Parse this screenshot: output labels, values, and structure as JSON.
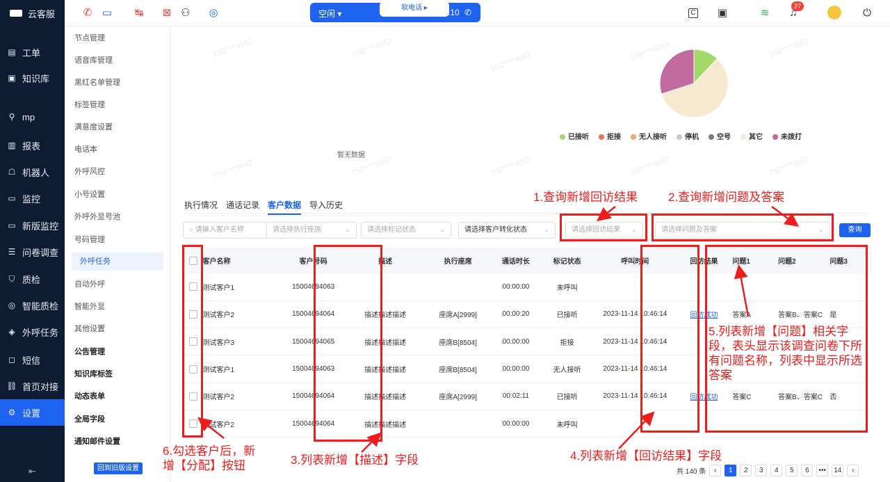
{
  "app_name": "云客服",
  "left_nav": [
    {
      "label": "工单",
      "icon": "ticket-icon"
    },
    {
      "label": "知识库",
      "icon": "book-icon"
    },
    {
      "label": "mp",
      "icon": "user-icon"
    },
    {
      "label": "报表",
      "icon": "chart-icon"
    },
    {
      "label": "机器人",
      "icon": "robot-icon"
    },
    {
      "label": "监控",
      "icon": "monitor-icon"
    },
    {
      "label": "新版监控",
      "icon": "monitor-icon"
    },
    {
      "label": "问卷调查",
      "icon": "survey-icon"
    },
    {
      "label": "质检",
      "icon": "shield-icon"
    },
    {
      "label": "智能质检",
      "icon": "target-icon"
    },
    {
      "label": "外呼任务",
      "icon": "layers-icon"
    },
    {
      "label": "短信",
      "icon": "message-icon"
    },
    {
      "label": "首页对接",
      "icon": "link-icon"
    },
    {
      "label": "设置",
      "icon": "gear-icon"
    }
  ],
  "sub_nav": [
    {
      "label": "节点管理"
    },
    {
      "label": "语音库管理"
    },
    {
      "label": "黑红名单管理"
    },
    {
      "label": "标签管理"
    },
    {
      "label": "满意度设置"
    },
    {
      "label": "电话本"
    },
    {
      "label": "外呼风控"
    },
    {
      "label": "小号设置"
    },
    {
      "label": "外呼外显号池"
    },
    {
      "label": "号码管理"
    },
    {
      "label": "外呼任务"
    },
    {
      "label": "自动外呼"
    },
    {
      "label": "智能外显"
    },
    {
      "label": "其他设置"
    },
    {
      "label": "公告管理"
    },
    {
      "label": "知识库标签"
    },
    {
      "label": "动态表单"
    },
    {
      "label": "全局字段"
    },
    {
      "label": "通知邮件设置"
    }
  ],
  "old_settings_btn": "回到旧版设置",
  "phone": {
    "status": "空闲 ▾",
    "soft_phone": "软电话 ▸",
    "timer": "00:10:10"
  },
  "notif_count": "27",
  "watermark": "150****4062",
  "legend": [
    {
      "label": "已接听",
      "color": "#a3d86a"
    },
    {
      "label": "拒接",
      "color": "#e8735a"
    },
    {
      "label": "无人接听",
      "color": "#f4a66a"
    },
    {
      "label": "停机",
      "color": "#c8c8c8"
    },
    {
      "label": "空号",
      "color": "#7a7a7a"
    },
    {
      "label": "其它",
      "color": "#f7e9cf"
    },
    {
      "label": "未拨打",
      "color": "#c26aa0"
    }
  ],
  "chart_data": {
    "type": "pie",
    "slices": [
      {
        "label": "已接听",
        "value": 12,
        "color": "#a3d86a"
      },
      {
        "label": "其它",
        "value": 58,
        "color": "#f7e9cf"
      },
      {
        "label": "未拨打",
        "value": 30,
        "color": "#c26aa0"
      }
    ]
  },
  "no_data": "暂无数据",
  "tabs": [
    {
      "label": "执行情况"
    },
    {
      "label": "通话记录"
    },
    {
      "label": "客户数据"
    },
    {
      "label": "导入历史"
    }
  ],
  "filters": {
    "name_placeholder": "请输入客户名称",
    "seat": "请选择执行座席",
    "mark": "请选择标记状态",
    "convert": "请选择客户转化状态",
    "visit": "请选择回访结果",
    "question": "请选择问题及答案",
    "query": "查询"
  },
  "table": {
    "headers": [
      "客户名称",
      "客户号码",
      "描述",
      "执行座席",
      "通话时长",
      "标记状态",
      "呼叫时间",
      "回访结果",
      "问题1",
      "问题2",
      "问题3"
    ],
    "rows": [
      [
        "测试客户1",
        "15004694063",
        "",
        "",
        "00:00:00",
        "未呼叫",
        "",
        "",
        "",
        "",
        ""
      ],
      [
        "测试客户2",
        "15004694064",
        "描述描述描述",
        "座席A[2999]",
        "00:00:20",
        "已接听",
        "2023-11-14 10:46:14",
        "回访成功",
        "答案A",
        "答案B、答案C",
        "是"
      ],
      [
        "测试客户3",
        "15004694065",
        "描述描述描述",
        "座席B[8504]",
        "00:00:00",
        "拒接",
        "2023-11-14 10:46:14",
        "",
        "",
        "",
        ""
      ],
      [
        "测试客户1",
        "15004694063",
        "描述描述描述",
        "座席B[8504]",
        "00:00:00",
        "无人接听",
        "2023-11-14 10:46:14",
        "",
        "",
        "",
        ""
      ],
      [
        "测试客户2",
        "15004694064",
        "描述描述描述",
        "座席A[2999]",
        "00:02:11",
        "已接听",
        "2023-11-14 10:46:14",
        "回访成功",
        "答案C",
        "答案B、答案C",
        "否"
      ],
      [
        "测试客户2",
        "15004694064",
        "描述描述描述",
        "",
        "00:00:00",
        "未呼叫",
        "",
        "",
        "",
        "",
        ""
      ]
    ]
  },
  "pager": {
    "total": "共 140 条",
    "pages": [
      "1",
      "2",
      "3",
      "4",
      "5",
      "6",
      "•••",
      "14"
    ]
  },
  "annotations": {
    "a1": "1.查询新增回访结果",
    "a2": "2.查询新增问题及答案",
    "a3": "3.列表新增【描述】字段",
    "a4": "4.列表新增【回访结果】字段",
    "a5": "5.列表新增【问题】相关字段，表头显示该调查问卷下所有问题名称，列表中显示所选答案",
    "a6": "6.勾选客户后，新增【分配】按钮"
  }
}
